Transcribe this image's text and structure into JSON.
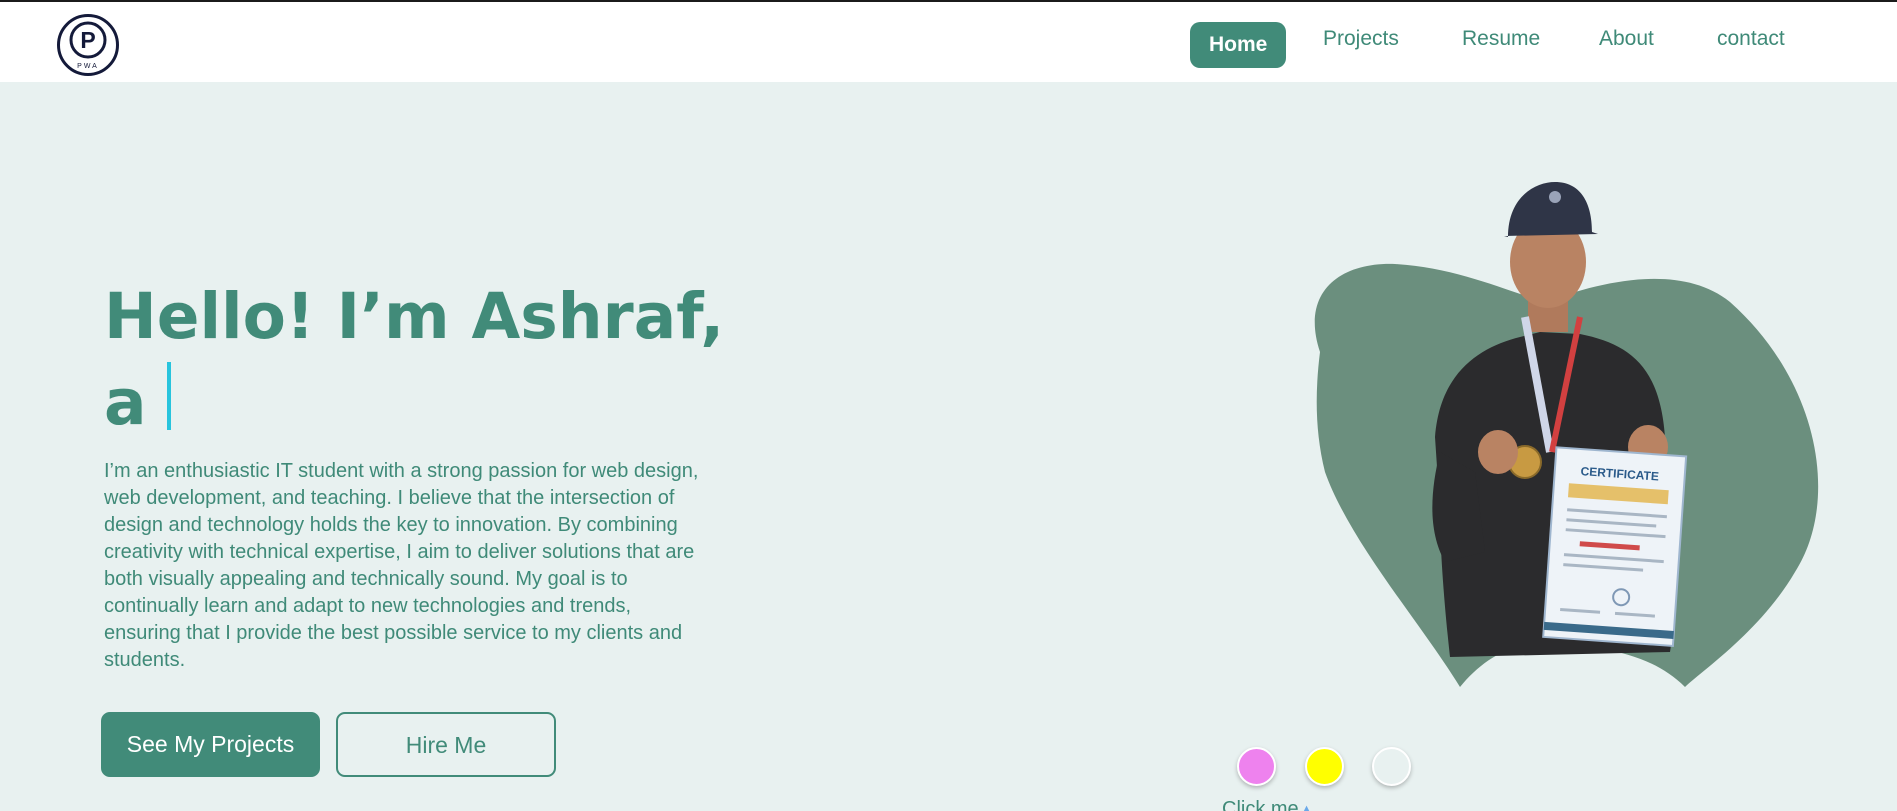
{
  "nav": {
    "items": [
      {
        "label": "Home",
        "active": true
      },
      {
        "label": "Projects",
        "active": false
      },
      {
        "label": "Resume",
        "active": false
      },
      {
        "label": "About",
        "active": false
      },
      {
        "label": "contact",
        "active": false
      }
    ]
  },
  "logo": {
    "monogram": "P",
    "text": "PWA"
  },
  "hero": {
    "title_line1": "Hello! I’m Ashraf,",
    "title_line2": "a",
    "description": "I’m an enthusiastic IT student with a strong passion for web design, web development, and teaching. I believe that the intersection of design and technology holds the key to innovation. By combining creativity with technical expertise, I aim to deliver solutions that are both visually appealing and technically sound. My goal is to continually learn and adapt to new technologies and trends, ensuring that I provide the best possible service to my clients and students.",
    "primary_button": "See My Projects",
    "secondary_button": "Hire Me"
  },
  "certificate": {
    "title": "CERTIFICATE"
  },
  "theme": {
    "dots": [
      "#ee82ee",
      "#ffff00",
      "#e8f1f0"
    ],
    "hint": "Click me",
    "hint_icon": "arrow-up-icon"
  },
  "colors": {
    "accent": "#418b79",
    "background": "#e8f1f0",
    "blob": "#6b8f7e",
    "caret": "#27c4dd"
  }
}
